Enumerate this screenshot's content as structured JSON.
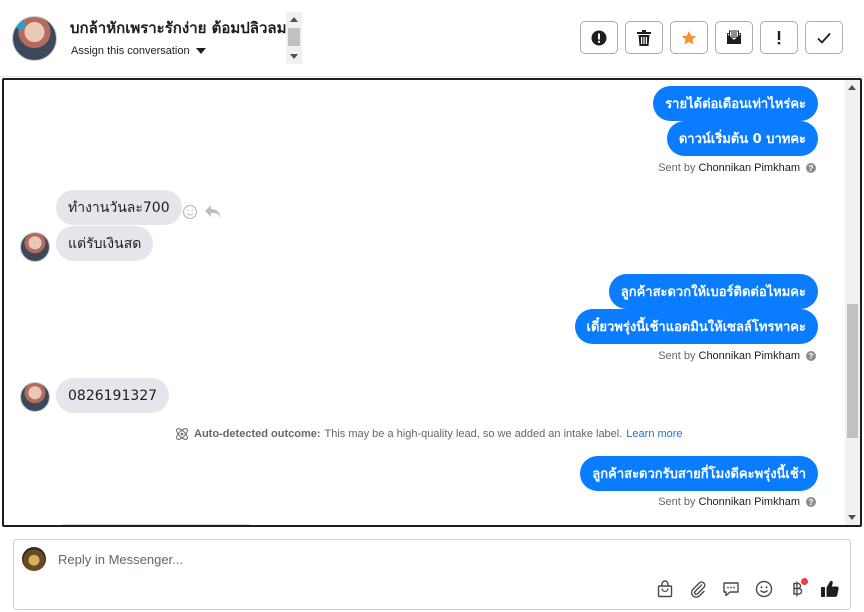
{
  "header": {
    "contact_name": "บกล้าหักเพราะรักง่าย ต้อมปลิวลม",
    "assign_label": "Assign this conversation"
  },
  "actions": [
    {
      "name": "spam",
      "icon": "exclamation-circle-icon"
    },
    {
      "name": "delete",
      "icon": "trash-icon"
    },
    {
      "name": "star",
      "icon": "star-icon",
      "color": "#f7923a"
    },
    {
      "name": "mark-unread",
      "icon": "envelope-icon"
    },
    {
      "name": "follow-up",
      "icon": "exclamation-icon"
    },
    {
      "name": "done",
      "icon": "check-icon"
    }
  ],
  "messages": [
    {
      "side": "out",
      "text": "รายได้ต่อเดือนเท่าไหร่คะ"
    },
    {
      "side": "out",
      "text": "ดาวน์เริ่มต้น 0 บาทคะ"
    },
    {
      "side": "sent_by",
      "prefix": "Sent by",
      "agent": "Chonnikan Pimkham"
    },
    {
      "side": "in",
      "text": "ทำงานวันละ700"
    },
    {
      "side": "in",
      "text": "แต่รับเงินสด"
    },
    {
      "side": "out",
      "text": "ลูกค้าสะดวกให้เบอร์ติดต่อไหมคะ"
    },
    {
      "side": "out",
      "text": "เดี๋ยวพรุ่งนี้เช้าแอดมินให้เซลล์โทรหาคะ"
    },
    {
      "side": "sent_by",
      "prefix": "Sent by",
      "agent": "Chonnikan Pimkham"
    },
    {
      "side": "in",
      "text": "0826191327"
    },
    {
      "side": "out",
      "text": "ลูกค้าสะดวกรับสายกี่โมงดีคะพรุ่งนี้เช้า"
    },
    {
      "side": "sent_by",
      "prefix": "Sent by",
      "agent": "Chonnikan Pimkham"
    }
  ],
  "outcome": {
    "label": "Auto-detected outcome:",
    "text": "This may be a high-quality lead, so we added an intake label.",
    "link": "Learn more"
  },
  "composer": {
    "placeholder": "Reply in Messenger..."
  },
  "colors": {
    "outgoing_bubble": "#0a7cff",
    "incoming_bubble": "#e4e6eb",
    "star": "#f7923a",
    "link": "#216fdb",
    "notification_dot": "#fa383e"
  }
}
